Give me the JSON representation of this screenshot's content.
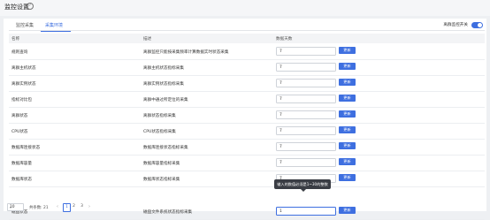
{
  "header": {
    "title": "监控设置",
    "help_icon": "?"
  },
  "tabs": [
    {
      "label": "监控采集"
    },
    {
      "label": "采集环境"
    }
  ],
  "switch": {
    "label": "离群监控开关",
    "on": true
  },
  "table": {
    "columns": [
      "名称",
      "描述",
      "数据天数"
    ],
    "rows": [
      {
        "name": "规则查询",
        "desc": "离群监控只能按采集频率计算数据实时状态采集",
        "value": "7",
        "action": "更新"
      },
      {
        "name": "离群主机状态",
        "desc": "离群主机状态指标采集",
        "value": "7",
        "action": "更新"
      },
      {
        "name": "离群实例状态",
        "desc": "离群实例状态指标采集",
        "value": "7",
        "action": "更新"
      },
      {
        "name": "指标对比包",
        "desc": "离群中通过所定位的采集",
        "value": "7",
        "action": "更新"
      },
      {
        "name": "离群状态",
        "desc": "离群状态指标采集",
        "value": "7",
        "action": "更新"
      },
      {
        "name": "CPU状态",
        "desc": "CPU状态指标采集",
        "value": "7",
        "action": "更新"
      },
      {
        "name": "数据库连接状态",
        "desc": "数据库连接状态指标采集",
        "value": "7",
        "action": "更新"
      },
      {
        "name": "数据库容量",
        "desc": "数据库容量指标采集",
        "value": "7",
        "action": "更新"
      },
      {
        "name": "数据库状态",
        "desc": "数据库状态指标采集",
        "value": "7",
        "action": "更新"
      },
      {
        "name": "磁盘状态",
        "desc": "磁盘文件系统状态指标采集",
        "value": "1",
        "action": "更新"
      }
    ]
  },
  "tooltip": {
    "text": "输入的数值必须是1~30的整数"
  },
  "pagination": {
    "page_size": "10",
    "total_text": "共条数: 21",
    "pages": [
      "1",
      "2",
      "3"
    ],
    "current": "1",
    "prev": "‹",
    "next": "›"
  }
}
